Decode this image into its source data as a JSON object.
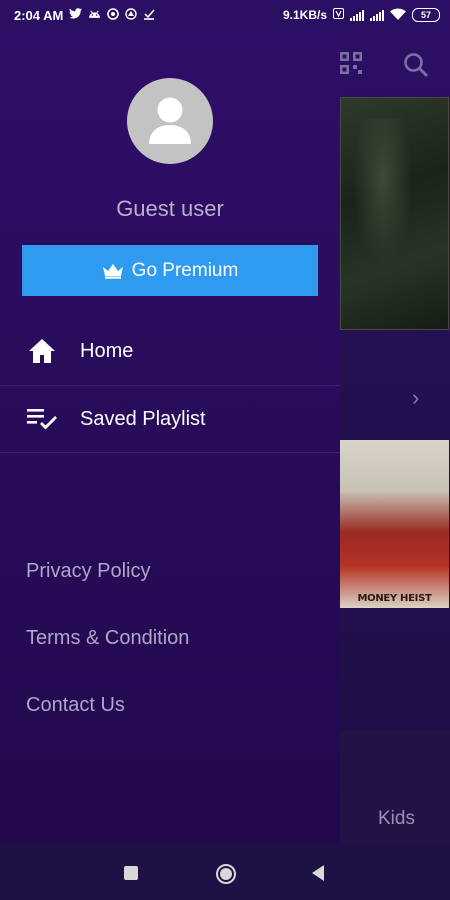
{
  "status_bar": {
    "time": "2:04 AM",
    "net_speed": "9.1KB/s",
    "battery": "57",
    "left_icons": [
      "twitter-icon",
      "android-icon",
      "circle-app-icon",
      "triangle-app-icon",
      "download-done-icon"
    ]
  },
  "drawer": {
    "user_name": "Guest user",
    "premium_label": "Go Premium",
    "nav_items": [
      {
        "label": "Home",
        "icon": "home-icon"
      },
      {
        "label": "Saved Playlist",
        "icon": "playlist-check-icon"
      }
    ],
    "footer_links": [
      "Privacy Policy",
      "Terms & Condition",
      "Contact Us"
    ]
  },
  "background_app": {
    "poster_title": "MONEY HEIST",
    "tab_label": "Kids"
  },
  "colors": {
    "drawer_bg": "#2b0d60",
    "premium_button": "#2e9bf0",
    "muted_text": "#b0a6c8",
    "nav_bar": "#1d1145"
  }
}
